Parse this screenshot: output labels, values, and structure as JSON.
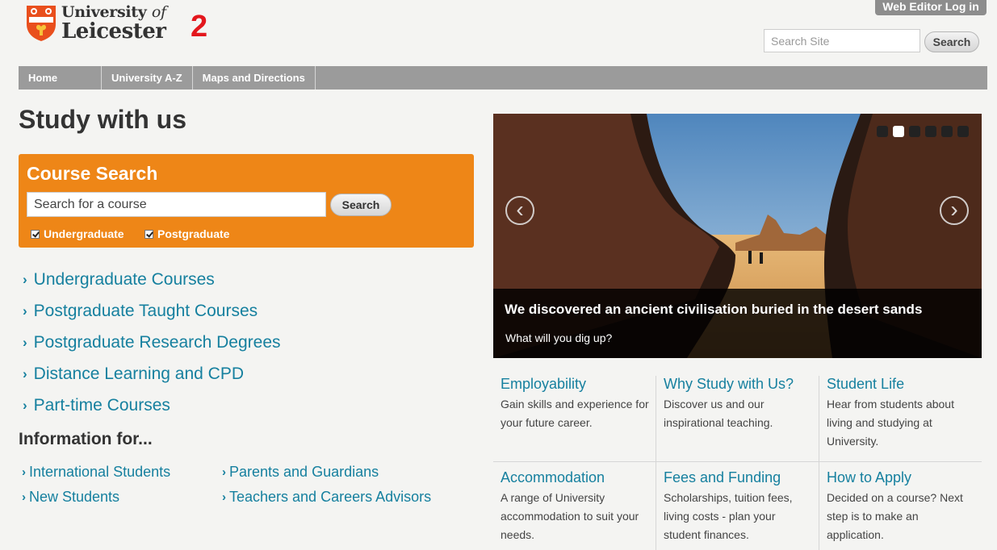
{
  "header": {
    "logo_line1": "University",
    "logo_line1_of": "of",
    "logo_line2": "Leicester",
    "logo_annotation": "2",
    "web_editor_label": "Web Editor Log in",
    "search_placeholder": "Search Site",
    "search_button": "Search"
  },
  "nav": {
    "items": [
      {
        "label": "Home"
      },
      {
        "label": "University A-Z"
      },
      {
        "label": "Maps and Directions"
      }
    ]
  },
  "main": {
    "title": "Study with us",
    "course_search": {
      "heading": "Course Search",
      "placeholder": "Search for a course",
      "button": "Search",
      "checkboxes": [
        {
          "label": "Undergraduate",
          "checked": true
        },
        {
          "label": "Postgraduate",
          "checked": true
        }
      ]
    },
    "course_links": [
      {
        "label": "Undergraduate Courses"
      },
      {
        "label": "Postgraduate Taught Courses"
      },
      {
        "label": "Postgraduate Research Degrees"
      },
      {
        "label": "Distance Learning and CPD"
      },
      {
        "label": "Part-time Courses"
      }
    ],
    "info_title": "Information for...",
    "info_links": [
      {
        "label": "International Students"
      },
      {
        "label": "Parents and Guardians"
      },
      {
        "label": "New Students"
      },
      {
        "label": "Teachers and Careers Advisors"
      }
    ]
  },
  "slider": {
    "caption_title": "We discovered an ancient civilisation buried in the desert sands",
    "caption_subtitle": "What will you dig up?",
    "prev_icon": "‹",
    "next_icon": "›",
    "slide_count": 6,
    "active_slide": 2
  },
  "features": [
    {
      "title": "Employability",
      "text": "Gain skills and experience for your future career."
    },
    {
      "title": "Why Study with Us?",
      "text": "Discover us and our inspirational teaching."
    },
    {
      "title": "Student Life",
      "text": "Hear from students about living and studying at University."
    },
    {
      "title": "Accommodation",
      "text": "A range of University accommodation to suit your needs."
    },
    {
      "title": "Fees and Funding",
      "text": "Scholarships, tuition fees, living costs - plan your student finances."
    },
    {
      "title": "How to Apply",
      "text": "Decided on a course? Next step is to make an application."
    }
  ],
  "colors": {
    "accent_orange": "#ee8617",
    "link_blue": "#16809f",
    "nav_grey": "#9b9b9b",
    "annotation_red": "#e3171d"
  }
}
